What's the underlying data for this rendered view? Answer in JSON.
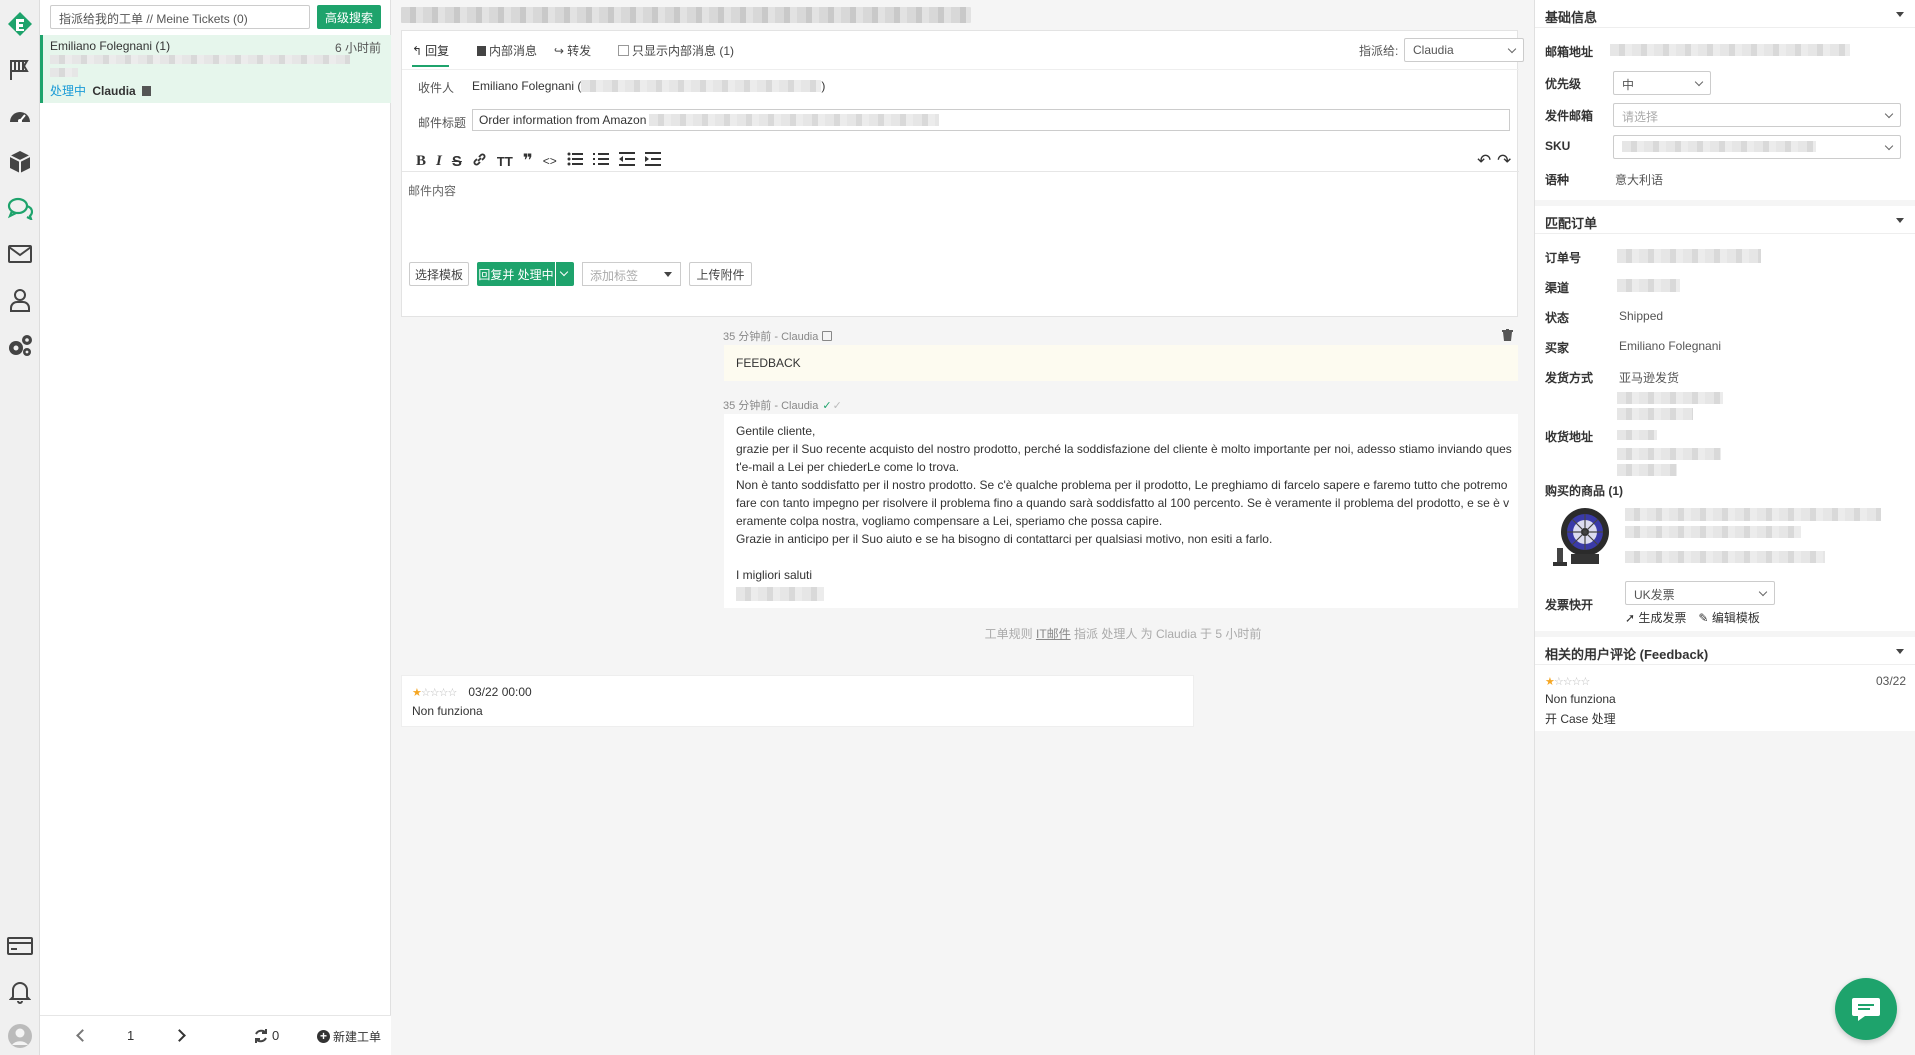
{
  "colors": {
    "accent": "#1ea36c",
    "link": "#1a9bd7",
    "star": "#f5a623"
  },
  "iconbar": {
    "items": [
      "logo-icon",
      "flag-icon",
      "dashboard-icon",
      "cube-icon",
      "chat-icon",
      "mail-icon",
      "user-icon",
      "gears-icon",
      "card-icon",
      "bell-icon",
      "avatar-icon"
    ]
  },
  "ticket_list": {
    "filter": "指派给我的工单 // Meine Tickets (0)",
    "advanced_search": "高级搜索",
    "items": [
      {
        "name": "Emiliano Folegnani (1)",
        "time": "6 小时前",
        "status": "处理中",
        "assignee": "Claudia"
      }
    ],
    "page": "1",
    "refresh_count": "0",
    "new_ticket": "新建工单"
  },
  "composer": {
    "tabs": [
      {
        "label": "回复"
      },
      {
        "label": "内部消息"
      },
      {
        "label": "转发"
      }
    ],
    "only_internal": "只显示内部消息 (1)",
    "assign_label": "指派给:",
    "assign_value": "Claudia",
    "recipient_label": "收件人",
    "recipient_name": "Emiliano Folegnani (",
    "recipient_close": ")",
    "subject_label": "邮件标题",
    "subject_value": "Order information from Amazon",
    "body_placeholder": "邮件内容",
    "template_button": "选择模板",
    "reply_button": "回复并 处理中",
    "tag_placeholder": "添加标签",
    "attach_button": "上传附件"
  },
  "thread": {
    "note": {
      "meta": "35 分钟前 - Claudia",
      "text": "FEEDBACK"
    },
    "message": {
      "meta": "35 分钟前 - Claudia",
      "lines": [
        "Gentile cliente,",
        "grazie per il Suo recente acquisto del nostro prodotto, perché la soddisfazione del cliente è molto importante per noi, adesso stiamo inviando ques",
        "t'e-mail a Lei per chiederLe come lo trova.",
        "Non è tanto soddisfatto per il nostro prodotto. Se c'è qualche problema per il prodotto, Le preghiamo di farcelo sapere e faremo tutto che potremo",
        "fare con tanto impegno per risolvere il problema fino a quando sarà soddisfatto al 100 percento. Se è veramente il problema del prodotto, e se è v",
        "eramente colpa nostra, vogliamo compensare a Lei, speriamo che possa capire.",
        "Grazie in anticipo per il Suo aiuto e se ha bisogno di contattarci per qualsiasi motivo, non esiti a farlo.",
        "",
        "I migliori saluti"
      ]
    },
    "rule": {
      "prefix": "工单规则",
      "rule_name": "IT邮件",
      "suffix": "指派 处理人 为 Claudia 于 5 小时前"
    },
    "review": {
      "stars": 1,
      "date": "03/22 00:00",
      "text": "Non funziona"
    }
  },
  "right_panel": {
    "basic": {
      "title": "基础信息",
      "email_label": "邮箱地址",
      "priority_label": "优先级",
      "priority_value": "中",
      "sender_label": "发件邮箱",
      "sender_placeholder": "请选择",
      "sku_label": "SKU",
      "lang_label": "语种",
      "lang_value": "意大利语"
    },
    "order": {
      "title": "匹配订单",
      "order_no_label": "订单号",
      "channel_label": "渠道",
      "status_label": "状态",
      "status_value": "Shipped",
      "buyer_label": "买家",
      "buyer_value": "Emiliano Folegnani",
      "ship_label": "发货方式",
      "ship_value": "亚马逊发货",
      "address_label": "收货地址",
      "products_label": "购买的商品 (1)",
      "invoice_label": "发票快开",
      "invoice_value": "UK发票",
      "gen_invoice": "生成发票",
      "edit_template": "编辑模板"
    },
    "feedback": {
      "title": "相关的用户评论 (Feedback)",
      "stars": 1,
      "date": "03/22",
      "text": "Non funziona",
      "case_link": "开 Case 处理"
    }
  }
}
